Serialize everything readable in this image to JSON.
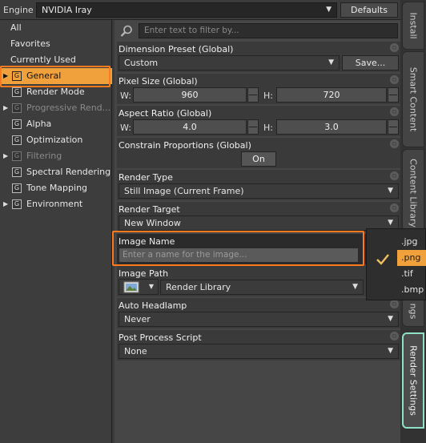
{
  "engine": {
    "label": "Engine :",
    "value": "NVIDIA Iray",
    "defaults_label": "Defaults"
  },
  "left_panel": {
    "top_items": [
      {
        "label": "All"
      },
      {
        "label": "Favorites"
      },
      {
        "label": "Currently Used"
      }
    ],
    "groups": [
      {
        "label": "General",
        "selected": true,
        "expandable": true,
        "disabled": false
      },
      {
        "label": "Render Mode",
        "selected": false,
        "expandable": false,
        "disabled": false
      },
      {
        "label": "Progressive Rend...",
        "selected": false,
        "expandable": true,
        "disabled": true
      },
      {
        "label": "Alpha",
        "selected": false,
        "expandable": false,
        "disabled": false
      },
      {
        "label": "Optimization",
        "selected": false,
        "expandable": false,
        "disabled": false
      },
      {
        "label": "Filtering",
        "selected": false,
        "expandable": true,
        "disabled": true
      },
      {
        "label": "Spectral Rendering",
        "selected": false,
        "expandable": false,
        "disabled": false
      },
      {
        "label": "Tone Mapping",
        "selected": false,
        "expandable": false,
        "disabled": false
      },
      {
        "label": "Environment",
        "selected": false,
        "expandable": true,
        "disabled": false
      }
    ],
    "group_icon_letter": "G"
  },
  "filter": {
    "placeholder": "Enter text to filter by..."
  },
  "properties": {
    "dimension_preset": {
      "title": "Dimension Preset (Global)",
      "value": "Custom",
      "save_label": "Save..."
    },
    "pixel_size": {
      "title": "Pixel Size (Global)",
      "w_label": "W:",
      "w_value": "960",
      "h_label": "H:",
      "h_value": "720"
    },
    "aspect_ratio": {
      "title": "Aspect Ratio (Global)",
      "w_label": "W:",
      "w_value": "4.0",
      "h_label": "H:",
      "h_value": "3.0"
    },
    "constrain": {
      "title": "Constrain Proportions (Global)",
      "value": "On"
    },
    "render_type": {
      "title": "Render Type",
      "value": "Still Image (Current Frame)"
    },
    "render_target": {
      "title": "Render Target",
      "value": "New Window"
    },
    "image_name": {
      "title": "Image Name",
      "placeholder": "Enter a name for the image..."
    },
    "image_path": {
      "title": "Image Path",
      "value": "Render Library"
    },
    "auto_headlamp": {
      "title": "Auto Headlamp",
      "value": "Never"
    },
    "post_process": {
      "title": "Post Process Script",
      "value": "None"
    }
  },
  "extension_popup": {
    "items": [
      ".jpg",
      ".png",
      ".tif",
      ".bmp"
    ],
    "selected": ".png"
  },
  "side_tabs": [
    "Install",
    "Smart Content",
    "Content Library",
    "ngs",
    "Render Settings"
  ],
  "colors": {
    "accent": "#f0a13c",
    "highlight_outline": "#ff7a1c",
    "active_tab_outline": "#8fe0c8"
  }
}
